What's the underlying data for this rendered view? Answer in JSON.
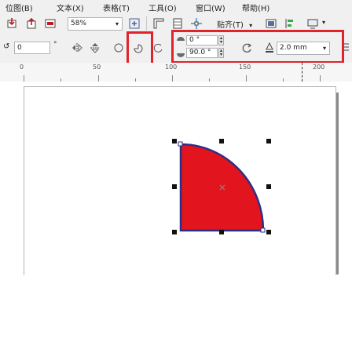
{
  "menu": [
    "位图(B)",
    "文本(X)",
    "表格(T)",
    "工具(O)",
    "窗口(W)",
    "帮助(H)"
  ],
  "toolbar": {
    "zoom": "58%",
    "snap_label": "贴齐(T)",
    "snap_arrow": "▾"
  },
  "property_bar": {
    "rotation_value": "0",
    "degree_symbol": "°",
    "start_angle": "0 °",
    "end_angle": "90.0 °",
    "outline_width": "2.0 mm"
  },
  "ruler": {
    "labels": [
      "0",
      "50",
      "100",
      "150",
      "200"
    ]
  },
  "colors": {
    "highlight": "#e1232b",
    "shape_fill": "#e2141d",
    "shape_outline": "#2b2f86"
  },
  "icons": {
    "pie": "pie-icon",
    "arc": "arc-icon",
    "ellipse": "ellipse-icon"
  }
}
